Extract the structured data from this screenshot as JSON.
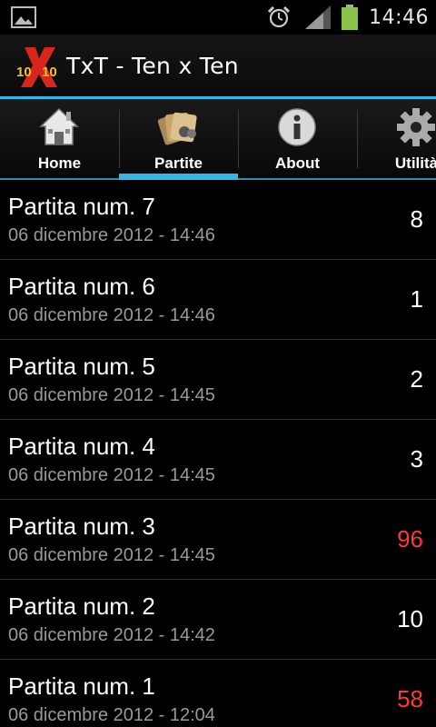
{
  "status_bar": {
    "time": "14:46",
    "icons": [
      "image-icon",
      "alarm-icon",
      "signal-icon",
      "battery-icon"
    ]
  },
  "app": {
    "title": "TxT - Ten x Ten",
    "logo_text_left": "10",
    "logo_text_right": "10",
    "accent_color": "#33b5e5"
  },
  "tabs": [
    {
      "label": "Home",
      "icon": "house-icon",
      "selected": false
    },
    {
      "label": "Partite",
      "icon": "cards-icon",
      "selected": true
    },
    {
      "label": "About",
      "icon": "info-icon",
      "selected": false
    },
    {
      "label": "Utilità",
      "icon": "gear-icon",
      "selected": false
    }
  ],
  "games": [
    {
      "name": "Partita num. 7",
      "date": "06 dicembre 2012 - 14:46",
      "score": "8",
      "highlight": false
    },
    {
      "name": "Partita num. 6",
      "date": "06 dicembre 2012 - 14:46",
      "score": "1",
      "highlight": false
    },
    {
      "name": "Partita num. 5",
      "date": "06 dicembre 2012 - 14:45",
      "score": "2",
      "highlight": false
    },
    {
      "name": "Partita num. 4",
      "date": "06 dicembre 2012 - 14:45",
      "score": "3",
      "highlight": false
    },
    {
      "name": "Partita num. 3",
      "date": "06 dicembre 2012 - 14:45",
      "score": "96",
      "highlight": true
    },
    {
      "name": "Partita num. 2",
      "date": "06 dicembre 2012 - 14:42",
      "score": "10",
      "highlight": false
    },
    {
      "name": "Partita num. 1",
      "date": "06 dicembre 2012 - 12:04",
      "score": "58",
      "highlight": true
    }
  ],
  "colors": {
    "highlight_score": "#ff3b30",
    "normal_score": "#ffffff",
    "date_text": "#9a9a9a",
    "battery": "#8bc34a"
  }
}
